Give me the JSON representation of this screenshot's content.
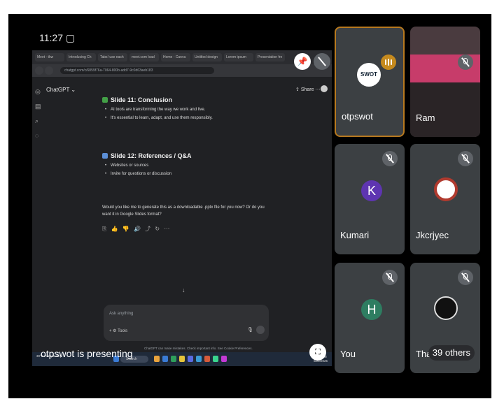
{
  "presentation": {
    "status_time": "11:27",
    "presenter_text": "otpswot is presenting",
    "browser": {
      "tabs": [
        "Meet - tkw",
        "Introducing Ch",
        "Tabs! use each",
        "meet.com load",
        "Home - Canva",
        "Untitled design",
        "Lorem ipsum",
        "Presentation fre"
      ],
      "url": "chatgpt.com/c/6859f76a-7064-800b-add7-9c0d63aeb183",
      "app_title": "ChatGPT",
      "share_label": "Share",
      "slide11": {
        "title": "Slide 11: Conclusion",
        "bullets": [
          "AI tools are transforming the way we work and live.",
          "It's essential to learn, adapt, and use them responsibly."
        ]
      },
      "slide12": {
        "title": "Slide 12: References / Q&A",
        "bullets": [
          "Websites or sources",
          "Invite for questions or discussion"
        ]
      },
      "question": "Would you like me to generate this as a downloadable .pptx file for you now? Or do you want it in Google Slides format?",
      "action_icons": "⎘ 👍 👎 🔊 ⤴ ↻ ⋯",
      "down_arrow": "↓",
      "ask_placeholder": "Ask anything",
      "tools_label": "+ ⚙ Tools",
      "disclaimer": "ChatGPT can make mistakes. Check important info. See Cookie Preferences.",
      "taskbar": {
        "weather": "30°C Partly sunny",
        "search_label": "Search",
        "time": "11:27 AM",
        "date": "6/22/2025"
      }
    }
  },
  "participants": [
    {
      "name": "otpswot",
      "avatar": "SWOT logo",
      "speaking": true
    },
    {
      "name": "Ram",
      "avatar": "camera video",
      "muted": true
    },
    {
      "name": "Kumari",
      "avatar_letter": "K",
      "avatar_color": "#5e35b1",
      "muted": true
    },
    {
      "name": "Jkcrjyec",
      "avatar": "college logo",
      "muted": true
    },
    {
      "name": "You",
      "avatar_letter": "H",
      "avatar_color": "#2e7d61",
      "muted": true
    },
    {
      "name": "Tharu",
      "avatar": "profile image",
      "muted": true
    }
  ],
  "others_label": "39 others",
  "colors": {
    "tile_bg": "#3c4043",
    "active_border": "#b7791f"
  }
}
